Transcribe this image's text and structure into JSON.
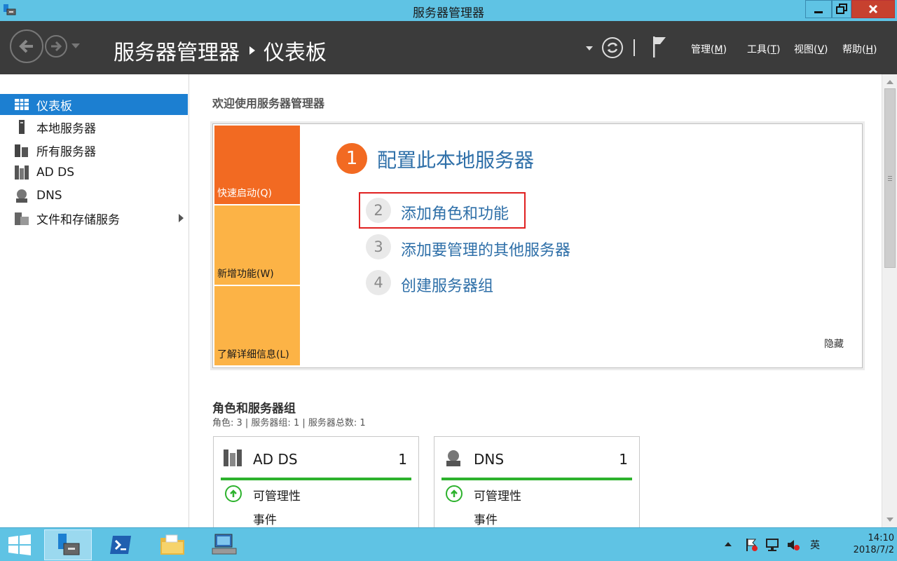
{
  "window": {
    "title": "服务器管理器"
  },
  "header": {
    "breadcrumb_root": "服务器管理器",
    "breadcrumb_current": "仪表板",
    "menus": [
      {
        "text": "管理(",
        "key": "M",
        "end": ")"
      },
      {
        "text": "工具(",
        "key": "T",
        "end": ")"
      },
      {
        "text": "视图(",
        "key": "V",
        "end": ")"
      },
      {
        "text": "帮助(",
        "key": "H",
        "end": ")"
      }
    ]
  },
  "sidebar": {
    "items": [
      {
        "label": "仪表板",
        "icon": "dashboard-icon",
        "active": true
      },
      {
        "label": "本地服务器",
        "icon": "server-icon"
      },
      {
        "label": "所有服务器",
        "icon": "servers-icon"
      },
      {
        "label": "AD DS",
        "icon": "ad-ds-icon"
      },
      {
        "label": "DNS",
        "icon": "dns-icon"
      },
      {
        "label": "文件和存储服务",
        "icon": "file-storage-icon",
        "expandable": true
      }
    ]
  },
  "welcome": {
    "title": "欢迎使用服务器管理器",
    "tiles": [
      "快速启动(Q)",
      "新增功能(W)",
      "了解详细信息(L)"
    ],
    "steps": [
      {
        "num": "1",
        "label": "配置此本地服务器"
      },
      {
        "num": "2",
        "label": "添加角色和功能"
      },
      {
        "num": "3",
        "label": "添加要管理的其他服务器"
      },
      {
        "num": "4",
        "label": "创建服务器组"
      }
    ],
    "hide": "隐藏"
  },
  "roles": {
    "title": "角色和服务器组",
    "summary": "角色: 3 | 服务器组: 1 | 服务器总数: 1",
    "cards": [
      {
        "name": "AD DS",
        "count": "1",
        "row1": "可管理性",
        "row2": "事件"
      },
      {
        "name": "DNS",
        "count": "1",
        "row1": "可管理性",
        "row2": "事件"
      }
    ]
  },
  "taskbar": {
    "ime": "英",
    "time": "14:10",
    "date": "2018/7/2"
  },
  "colors": {
    "titlebar": "#5fc3e4",
    "header": "#3b3b3b",
    "accent": "#1c7fd1",
    "orange": "#f26a22",
    "amber": "#fcb346",
    "link": "#2e6fa8",
    "status_ok": "#2db22d",
    "highlight": "#e02020"
  }
}
